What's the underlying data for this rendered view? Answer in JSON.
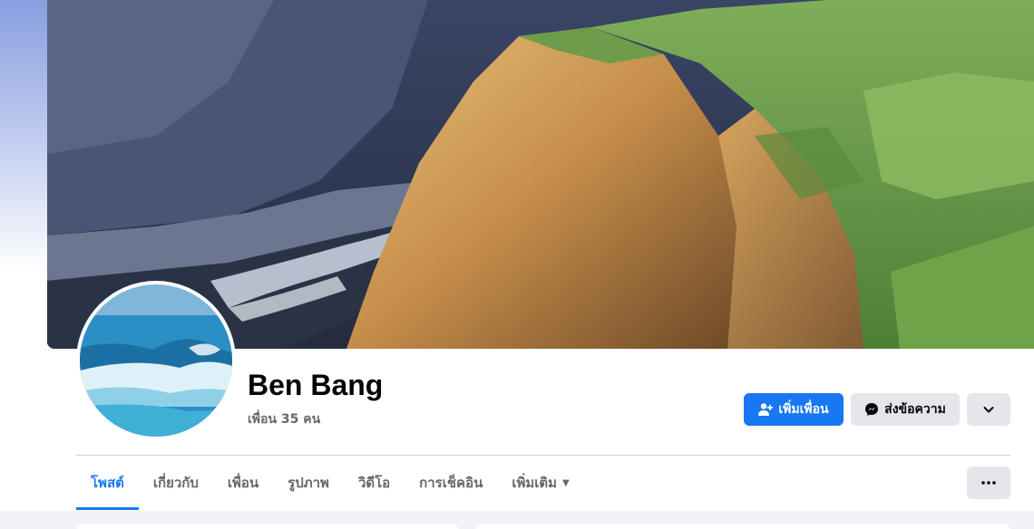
{
  "profile": {
    "name": "Ben Bang",
    "friends_count": "เพื่อน 35 คน"
  },
  "actions": {
    "add_friend_label": "เพิ่มเพื่อน",
    "message_label": "ส่งข้อความ",
    "add_friend_icon": "person-add-icon",
    "message_icon": "messenger-icon",
    "more_icon": "chevron-down-icon"
  },
  "tabs": [
    {
      "label": "โพสต์",
      "active": true
    },
    {
      "label": "เกี่ยวกับ",
      "active": false
    },
    {
      "label": "เพื่อน",
      "active": false
    },
    {
      "label": "รูปภาพ",
      "active": false
    },
    {
      "label": "วิดีโอ",
      "active": false
    },
    {
      "label": "การเช็คอิน",
      "active": false
    },
    {
      "label": "เพิ่มเติม",
      "active": false
    }
  ],
  "tabs_more_icon": "ellipsis-icon",
  "colors": {
    "accent": "#1877f2",
    "secondary_button": "#e4e6eb",
    "muted_text": "#65676b",
    "page_background": "#f0f2f5"
  }
}
